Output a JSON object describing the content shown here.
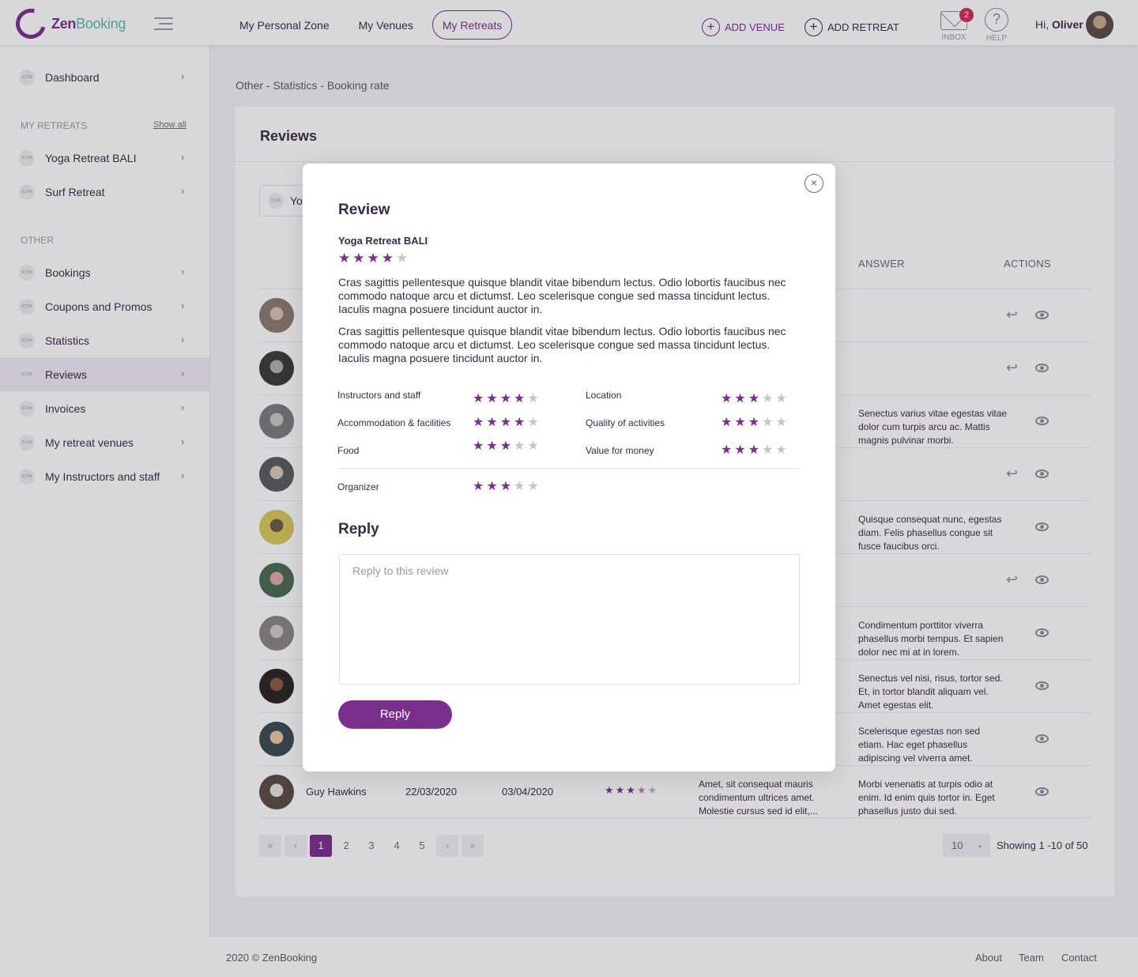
{
  "brand": {
    "name_part1": "Zen",
    "name_part2": "Booking",
    "accent": "#7a2f8c",
    "secondary": "#56bfb2"
  },
  "topnav": {
    "links": [
      {
        "label": "My Personal Zone",
        "active": false
      },
      {
        "label": "My Venues",
        "active": false
      },
      {
        "label": "My Retreats",
        "active": true
      }
    ],
    "add_venue": "ADD VENUE",
    "add_retreat": "ADD RETREAT",
    "inbox_label": "INBOX",
    "inbox_count": "2",
    "help_label": "HELP",
    "greeting_prefix": "Hi,",
    "user_name": "Oliver"
  },
  "sidebar": {
    "dashboard": "Dashboard",
    "icon_text": "ICON",
    "retreats_heading": "MY RETREATS",
    "show_all": "Show all",
    "retreats": [
      "Yoga Retreat BALI",
      "Surf Retreat"
    ],
    "other_heading": "OTHER",
    "other_items": [
      "Bookings",
      "Coupons and Promos",
      "Statistics",
      "Reviews",
      "Invoices",
      "My retreat venues",
      "My Instructors and staff"
    ],
    "active_item": "Reviews"
  },
  "breadcrumb": "Other - Statistics - Booking rate",
  "reviews_page": {
    "title": "Reviews",
    "filter_value": "Yo",
    "columns": {
      "answer": "ANSWER",
      "actions": "ACTIONS"
    },
    "rows": [
      {
        "answer": "",
        "has_reply": true
      },
      {
        "answer": "",
        "has_reply": true
      },
      {
        "answer": "Senectus varius vitae egestas vitae dolor cum turpis arcu ac. Mattis magnis pulvinar morbi.",
        "has_reply": false
      },
      {
        "answer": "",
        "has_reply": true
      },
      {
        "answer": "Quisque consequat nunc, egestas diam. Felis phasellus congue sit fusce faucibus orci.",
        "has_reply": false
      },
      {
        "answer": "",
        "has_reply": true
      },
      {
        "answer": "Condimentum porttitor viverra phasellus morbi tempus. Et sapien dolor nec mi at in lorem.",
        "has_reply": false
      },
      {
        "answer": "Senectus vel nisi, risus, tortor sed. Et, in tortor blandit aliquam vel. Amet egestas elit.",
        "has_reply": false
      },
      {
        "answer": "Scelerisque egestas non sed etiam. Hac eget phasellus adipiscing vel viverra amet.",
        "has_reply": false
      },
      {
        "name": "Guy Hawkins",
        "date_stay": "22/03/2020",
        "date_review": "03/04/2020",
        "rating": 3.5,
        "review": "Amet, sit consequat mauris condimentum ultrices amet. Molestie cursus sed id elit,...",
        "answer": "Morbi venenatis at turpis odio at enim. Id enim quis tortor in. Eget phasellus justo dui sed.",
        "has_reply": false
      }
    ],
    "pagination": {
      "pages": [
        "1",
        "2",
        "3",
        "4",
        "5"
      ],
      "current": "1",
      "first": "«",
      "prev": "‹",
      "next": "›",
      "last": "»"
    },
    "per_page": "10",
    "showing": "Showing 1 -10 of 50"
  },
  "footer": {
    "copyright": "2020 © ZenBooking",
    "links": [
      "About",
      "Team",
      "Contact"
    ]
  },
  "modal": {
    "title": "Review",
    "retreat": "Yoga Retreat BALI",
    "overall_rating": 4,
    "paragraphs": [
      "Cras sagittis pellentesque quisque blandit vitae bibendum lectus. Odio lobortis faucibus nec commodo natoque arcu et dictumst. Leo scelerisque congue sed massa tincidunt lectus. Iaculis magna posuere tincidunt auctor in.",
      "Cras sagittis pellentesque quisque blandit vitae bibendum lectus. Odio lobortis faucibus nec commodo natoque arcu et dictumst. Leo scelerisque congue sed massa tincidunt lectus. Iaculis magna posuere tincidunt auctor in."
    ],
    "ratings": [
      {
        "label": "Instructors and staff",
        "stars": 4
      },
      {
        "label": "Location",
        "stars": 3
      },
      {
        "label": "Accommodation & facilities",
        "stars": 4
      },
      {
        "label": "Quality of activities",
        "stars": 3
      },
      {
        "label": "Food",
        "stars": 3
      },
      {
        "label": "Value for money",
        "stars": 3
      },
      {
        "label": "Organizer",
        "stars": 3
      }
    ],
    "reply_title": "Reply",
    "reply_placeholder": "Reply to this review",
    "reply_button": "Reply",
    "close_glyph": "×"
  }
}
